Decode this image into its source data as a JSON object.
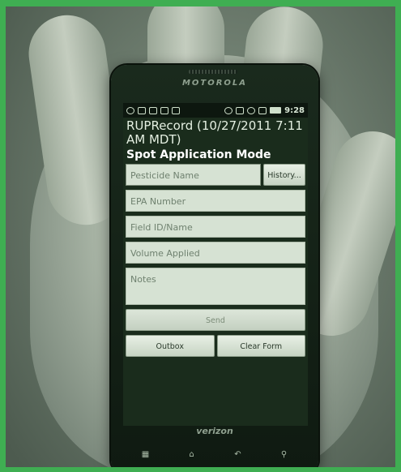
{
  "device": {
    "brand": "MOTOROLA",
    "carrier": "verizon",
    "nav_keys": [
      "menu-icon",
      "home-icon",
      "back-icon",
      "search-icon"
    ]
  },
  "statusbar": {
    "time": "9:28",
    "icons": [
      "add-icon",
      "image-icon",
      "voicemail-icon",
      "missed-call-icon",
      "gallery-icon",
      "bluetooth-icon",
      "vibrate-icon",
      "wifi-icon",
      "signal-icon",
      "battery-icon"
    ]
  },
  "app": {
    "title": "RUPRecord (10/27/2011 7:11 AM MDT)",
    "mode": "Spot Application Mode"
  },
  "form": {
    "pesticide_placeholder": "Pesticide Name",
    "history_label": "History...",
    "epa_placeholder": "EPA Number",
    "field_placeholder": "Field ID/Name",
    "volume_placeholder": "Volume Applied",
    "notes_placeholder": "Notes",
    "send_label": "Send",
    "outbox_label": "Outbox",
    "clear_label": "Clear Form"
  },
  "colors": {
    "frame": "#3fae52",
    "screen_bg": "#1a2c1c",
    "field_bg": "#d6e2d3"
  }
}
